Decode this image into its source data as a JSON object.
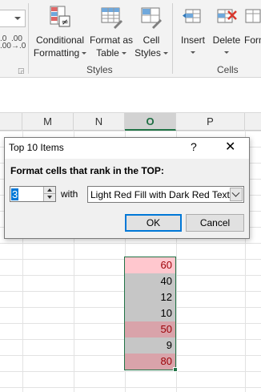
{
  "ribbon": {
    "decimal_increase": ".0",
    "decimal_increase_sub": ".00",
    "decimal_decrease": ".00",
    "decimal_decrease_sub": "→.0",
    "styles_group": {
      "label": "Styles",
      "conditional_formatting": [
        "Conditional",
        "Formatting"
      ],
      "format_as_table": [
        "Format as",
        "Table"
      ],
      "cell_styles": [
        "Cell",
        "Styles"
      ]
    },
    "cells_group": {
      "label": "Cells",
      "insert": "Insert",
      "delete": "Delete",
      "format": "Form"
    }
  },
  "columns": [
    "M",
    "N",
    "O",
    "P"
  ],
  "active_column": "O",
  "cells": [
    {
      "value": "60",
      "highlight": true
    },
    {
      "value": "40",
      "highlight": false
    },
    {
      "value": "12",
      "highlight": false
    },
    {
      "value": "10",
      "highlight": false
    },
    {
      "value": "50",
      "highlight": true
    },
    {
      "value": "9",
      "highlight": false
    },
    {
      "value": "80",
      "highlight": true
    }
  ],
  "colors": {
    "highlight_fill": "#ffc7ce",
    "highlight_text": "#9c0006",
    "selection_fill": "#c6c6c6",
    "selection_highlight_fill": "#d9a3aa",
    "accent_green": "#217346",
    "ok_border": "#0078d7"
  },
  "dialog": {
    "title": "Top 10 Items",
    "help": "?",
    "close": "✕",
    "prompt": "Format cells that rank in the TOP:",
    "count_value": "3",
    "with_label": "with",
    "format_selected": "Light Red Fill with Dark Red Text",
    "ok_label": "OK",
    "cancel_label": "Cancel"
  }
}
